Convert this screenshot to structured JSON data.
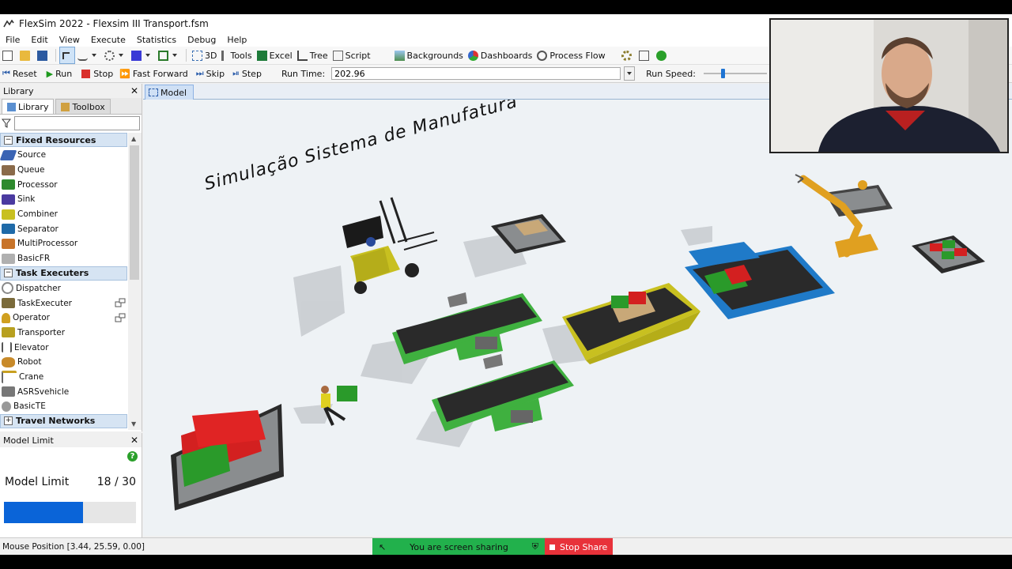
{
  "window": {
    "title": "FlexSim 2022 - Flexsim III Transport.fsm"
  },
  "menu": [
    "File",
    "Edit",
    "View",
    "Execute",
    "Statistics",
    "Debug",
    "Help"
  ],
  "toolbar1": {
    "btn_3d": "3D",
    "btn_tools": "Tools",
    "btn_excel": "Excel",
    "btn_tree": "Tree",
    "btn_script": "Script",
    "btn_backgrounds": "Backgrounds",
    "btn_dashboards": "Dashboards",
    "btn_processflow": "Process Flow"
  },
  "toolbar2": {
    "reset": "Reset",
    "run": "Run",
    "stop": "Stop",
    "fastforward": "Fast Forward",
    "skip": "Skip",
    "step": "Step",
    "runtime_label": "Run Time:",
    "runtime_value": "202.96",
    "runspeed_label": "Run Speed:",
    "runspeed_fraction": 0.3
  },
  "library": {
    "title": "Library",
    "tabs": {
      "library": "Library",
      "toolbox": "Toolbox"
    },
    "categories": {
      "fixed": "Fixed Resources",
      "task": "Task Executers",
      "travel": "Travel Networks"
    },
    "fixed_items": [
      "Source",
      "Queue",
      "Processor",
      "Sink",
      "Combiner",
      "Separator",
      "MultiProcessor",
      "BasicFR"
    ],
    "task_items": [
      "Dispatcher",
      "TaskExecuter",
      "Operator",
      "Transporter",
      "Elevator",
      "Robot",
      "Crane",
      "ASRSvehicle",
      "BasicTE"
    ]
  },
  "model_limit": {
    "title": "Model Limit",
    "label": "Model Limit",
    "value": "18 / 30",
    "current": 18,
    "max": 30
  },
  "model_tab": "Model",
  "scene": {
    "title": "Simulação Sistema de Manufatura"
  },
  "status": {
    "mouse_position": "Mouse Position [3.44, 25.59, 0.00]"
  },
  "screen_share": {
    "message": "You are screen sharing",
    "stop": "Stop Share"
  },
  "colors": {
    "accent": "#0a64d8",
    "share_green": "#22b14c",
    "share_red": "#e8323a"
  }
}
